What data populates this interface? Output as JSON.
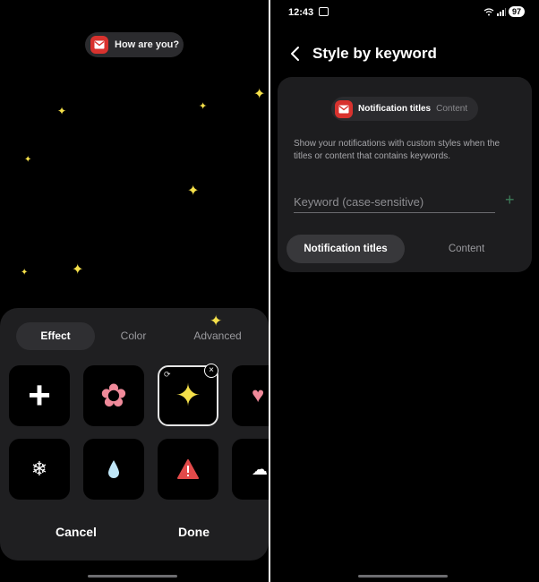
{
  "left": {
    "preview_text": "How are you?",
    "tabs": [
      {
        "label": "Effect",
        "active": true
      },
      {
        "label": "Color",
        "active": false
      },
      {
        "label": "Advanced",
        "active": false
      }
    ],
    "effects_row1": [
      {
        "icon": "plus-icon",
        "glyph": "+"
      },
      {
        "icon": "flower-icon",
        "glyph": "✿"
      },
      {
        "icon": "sparkle-icon",
        "glyph": "✦",
        "selected": true
      },
      {
        "icon": "heart-icon",
        "glyph": "♥"
      }
    ],
    "effects_row2": [
      {
        "icon": "snowflake-icon",
        "glyph": "❄"
      },
      {
        "icon": "droplet-icon",
        "glyph": "💧"
      },
      {
        "icon": "alert-icon",
        "glyph": "!"
      },
      {
        "icon": "cloud-icon",
        "glyph": "☁"
      }
    ],
    "cancel_label": "Cancel",
    "done_label": "Done",
    "colors": {
      "sheet": "#1f1f21",
      "sparkle": "#f5e04a",
      "mail": "#d8322e"
    }
  },
  "right": {
    "status": {
      "time": "12:43",
      "battery": "97"
    },
    "title": "Style by keyword",
    "pill": {
      "title": "Notification titles",
      "content": "Content"
    },
    "description": "Show your notifications with custom styles when the titles or content that contains keywords.",
    "keyword_placeholder": "Keyword (case-sensitive)",
    "add_label": "+",
    "segments": [
      {
        "label": "Notification titles",
        "active": true
      },
      {
        "label": "Content",
        "active": false
      }
    ],
    "colors": {
      "card": "#1d1d1f",
      "add": "#3d7b58"
    }
  }
}
